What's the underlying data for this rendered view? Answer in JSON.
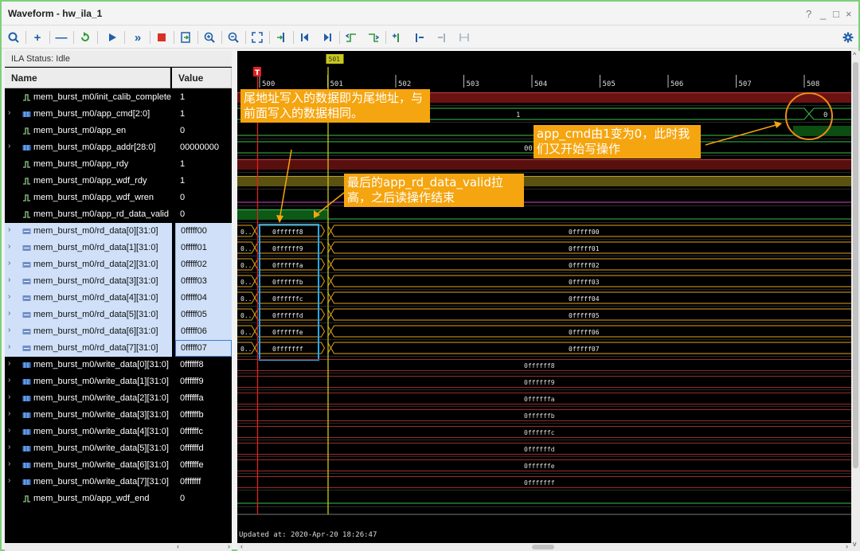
{
  "window": {
    "title": "Waveform - hw_ila_1",
    "controls": [
      "?",
      "_",
      "□",
      "×"
    ]
  },
  "toolbar": {
    "icons": [
      "search-icon",
      "add-icon",
      "remove-icon",
      "refresh-icon",
      "run-icon",
      "run-all-icon",
      "stop-icon",
      "export-icon",
      "zoom-in-icon",
      "zoom-out-icon",
      "zoom-fit-icon",
      "goto-cursor-icon",
      "goto-first-icon",
      "goto-last-icon",
      "prev-transition-icon",
      "next-transition-icon",
      "add-marker-icon",
      "prev-marker-icon",
      "next-marker-icon",
      "swap-cursor-icon",
      "gear-icon"
    ]
  },
  "ila_status": "ILA Status: Idle",
  "columns": {
    "name": "Name",
    "value": "Value"
  },
  "signals": [
    {
      "name": "mem_burst_m0/init_calib_complete",
      "value": "1",
      "type": "bit"
    },
    {
      "name": "mem_burst_m0/app_cmd[2:0]",
      "value": "1",
      "type": "bus"
    },
    {
      "name": "mem_burst_m0/app_en",
      "value": "0",
      "type": "bit"
    },
    {
      "name": "mem_burst_m0/app_addr[28:0]",
      "value": "00000000",
      "type": "bus"
    },
    {
      "name": "mem_burst_m0/app_rdy",
      "value": "1",
      "type": "bit"
    },
    {
      "name": "mem_burst_m0/app_wdf_rdy",
      "value": "1",
      "type": "bit"
    },
    {
      "name": "mem_burst_m0/app_wdf_wren",
      "value": "0",
      "type": "bit"
    },
    {
      "name": "mem_burst_m0/app_rd_data_valid",
      "value": "0",
      "type": "bit"
    },
    {
      "name": "mem_burst_m0/rd_data[0][31:0]",
      "value": "0fffff00",
      "type": "rbus"
    },
    {
      "name": "mem_burst_m0/rd_data[1][31:0]",
      "value": "0fffff01",
      "type": "rbus"
    },
    {
      "name": "mem_burst_m0/rd_data[2][31:0]",
      "value": "0fffff02",
      "type": "rbus"
    },
    {
      "name": "mem_burst_m0/rd_data[3][31:0]",
      "value": "0fffff03",
      "type": "rbus"
    },
    {
      "name": "mem_burst_m0/rd_data[4][31:0]",
      "value": "0fffff04",
      "type": "rbus"
    },
    {
      "name": "mem_burst_m0/rd_data[5][31:0]",
      "value": "0fffff05",
      "type": "rbus"
    },
    {
      "name": "mem_burst_m0/rd_data[6][31:0]",
      "value": "0fffff06",
      "type": "rbus"
    },
    {
      "name": "mem_burst_m0/rd_data[7][31:0]",
      "value": "0fffff07",
      "type": "rbus"
    },
    {
      "name": "mem_burst_m0/write_data[0][31:0]",
      "value": "0ffffff8",
      "type": "bus"
    },
    {
      "name": "mem_burst_m0/write_data[1][31:0]",
      "value": "0ffffff9",
      "type": "bus"
    },
    {
      "name": "mem_burst_m0/write_data[2][31:0]",
      "value": "0ffffffa",
      "type": "bus"
    },
    {
      "name": "mem_burst_m0/write_data[3][31:0]",
      "value": "0ffffffb",
      "type": "bus"
    },
    {
      "name": "mem_burst_m0/write_data[4][31:0]",
      "value": "0ffffffc",
      "type": "bus"
    },
    {
      "name": "mem_burst_m0/write_data[5][31:0]",
      "value": "0ffffffd",
      "type": "bus"
    },
    {
      "name": "mem_burst_m0/write_data[6][31:0]",
      "value": "0ffffffe",
      "type": "bus"
    },
    {
      "name": "mem_burst_m0/write_data[7][31:0]",
      "value": "0fffffff",
      "type": "bus"
    },
    {
      "name": "mem_burst_m0/app_wdf_end",
      "value": "0",
      "type": "bit"
    }
  ],
  "waveform": {
    "time_ticks": [
      "500",
      "501",
      "502",
      "503",
      "504",
      "505",
      "506",
      "507",
      "508"
    ],
    "trigger_marker": "T",
    "cursor_label": "501",
    "rd_left_prefix": "0..",
    "rd_before": [
      "0ffffff8",
      "0ffffff9",
      "0ffffffa",
      "0ffffffb",
      "0ffffffc",
      "0ffffffd",
      "0ffffffe",
      "0fffffff"
    ],
    "rd_after": [
      "0fffff00",
      "0fffff01",
      "0fffff02",
      "0fffff03",
      "0fffff04",
      "0fffff05",
      "0fffff06",
      "0fffff07"
    ],
    "app_cmd_before": "1",
    "app_cmd_after": "0",
    "app_addr_partial": "00",
    "write_values": [
      "0ffffff8",
      "0ffffff9",
      "0ffffffa",
      "0ffffffb",
      "0ffffffc",
      "0ffffffd",
      "0ffffffe",
      "0fffffff"
    ],
    "updated_at": "Updated at: 2020-Apr-20 18:26:47"
  },
  "annotations": [
    "尾地址写入的数据即为尾地址，与前面写入的数据相同。",
    "app_cmd由1变为0，此时我们又开始写操作",
    "最后的app_rd_data_valid拉高，之后读操作结束"
  ],
  "colors": {
    "bus_green": "#33c24a",
    "bus_gold": "#e3a21a",
    "cursor_yellow": "#c8c81e",
    "trigger_red": "#e02020",
    "annotation_orange": "#f5a50f",
    "box_blue": "#28a8e8",
    "selection_blue": "#cfe0f8"
  }
}
